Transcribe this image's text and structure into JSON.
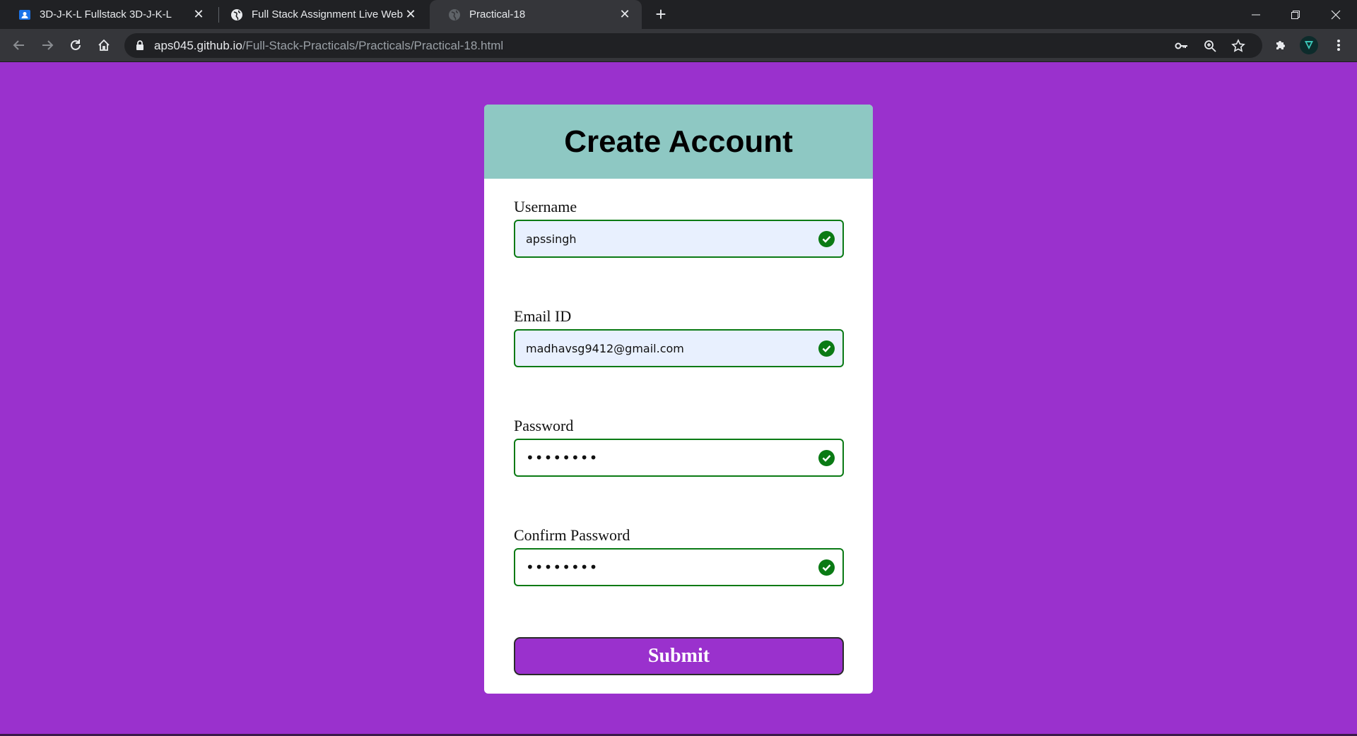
{
  "browser": {
    "tabs": [
      {
        "title": "3D-J-K-L Fullstack 3D-J-K-L",
        "favicon": "google-classroom-icon",
        "active": false
      },
      {
        "title": "Full Stack Assignment Live WebPage",
        "favicon": "globe-icon",
        "active": false
      },
      {
        "title": "Practical-18",
        "favicon": "globe-icon",
        "active": true
      }
    ],
    "url_host": "aps045.github.io",
    "url_path": "/Full-Stack-Practicals/Practicals/Practical-18.html"
  },
  "page": {
    "title": "Create Account",
    "fields": [
      {
        "label": "Username",
        "value": "apssingh",
        "type": "text",
        "valid": true
      },
      {
        "label": "Email ID",
        "value": "madhavsg9412@gmail.com",
        "type": "email",
        "valid": true
      },
      {
        "label": "Password",
        "value": "••••••••",
        "type": "password",
        "valid": true
      },
      {
        "label": "Confirm Password",
        "value": "••••••••",
        "type": "password",
        "valid": true
      }
    ],
    "submit_label": "Submit"
  },
  "colors": {
    "page_bg": "#9a31cd",
    "header_bg": "#8ec8c3",
    "valid_green": "#0a7a14",
    "autofill_bg": "#e8f0fe"
  }
}
